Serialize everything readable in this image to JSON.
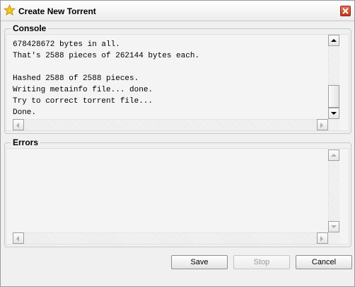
{
  "window": {
    "title": "Create New Torrent",
    "title_icon": "star-icon",
    "close_icon": "close-icon"
  },
  "console": {
    "label": "Console",
    "lines": [
      "678428672 bytes in all.",
      "That's 2588 pieces of 262144 bytes each.",
      "",
      "Hashed 2588 of 2588 pieces.",
      "Writing metainfo file... done.",
      "Try to correct torrent file...",
      "Done."
    ]
  },
  "errors": {
    "label": "Errors",
    "lines": []
  },
  "buttons": {
    "save": "Save",
    "stop": "Stop",
    "cancel": "Cancel"
  },
  "colors": {
    "window_bg": "#f0f0f0",
    "close_button": "#d04a2e",
    "star": "#f5c518"
  }
}
